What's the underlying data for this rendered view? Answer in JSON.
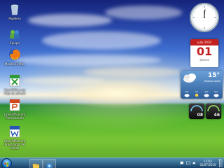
{
  "desktop_icons": [
    {
      "label": "Papelera",
      "icon": "recycle-bin-icon"
    },
    {
      "label": "Equipo",
      "icon": "network-icon"
    },
    {
      "label": "Mozilla Firefox",
      "icon": "firefox-icon"
    },
    {
      "label": "OpenOffice.org Hoja de cálculo",
      "icon": "spreadsheet-icon"
    },
    {
      "label": "OpenOffice.org Presentación",
      "icon": "presentation-icon"
    },
    {
      "label": "OpenOffice.org Procesador de textos",
      "icon": "writer-icon"
    }
  ],
  "calendar": {
    "month": "julio 2010",
    "day": "01",
    "weekday": "Jueves"
  },
  "weather": {
    "temp": "15°",
    "city": "Buenos Aires",
    "days": [
      "Thu",
      "Fri",
      "Sat",
      "Sun"
    ]
  },
  "meters": {
    "cpu": "08",
    "mem": "46"
  },
  "taskbar": {
    "time": "13:02",
    "date": "01/07/2010"
  },
  "colors": {
    "calendar_red": "#c41f1f",
    "taskbar": "#1e4f8a"
  }
}
